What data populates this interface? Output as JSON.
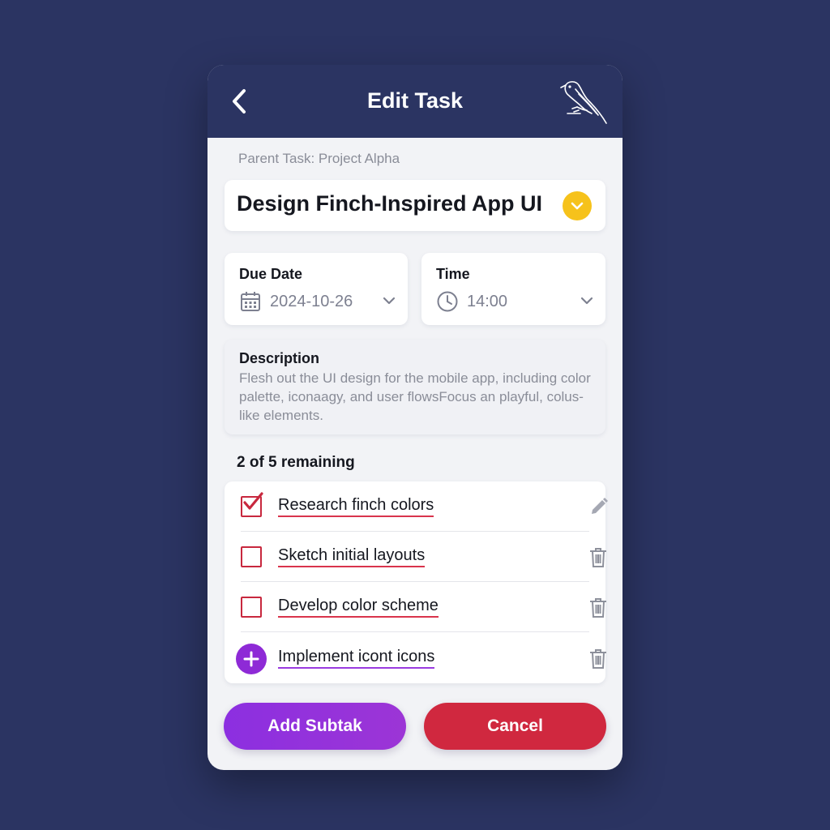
{
  "header": {
    "title": "Edit Task",
    "back_icon": "chevron-left-icon",
    "logo_icon": "finch-bird-icon"
  },
  "task": {
    "parent_label": "Parent Task: Project Alpha",
    "title": "Design Finch-Inspired App UI",
    "status_icon": "check-circle-icon",
    "status_color": "#f6c21b"
  },
  "due_date": {
    "label": "Due Date",
    "value": "2024-10-26",
    "icon": "calendar-icon"
  },
  "time": {
    "label": "Time",
    "value": "14:00",
    "icon": "clock-icon"
  },
  "description": {
    "label": "Description",
    "text": "Flesh out the UI design for the mobile app, including color palette, iconaagy, and user flowsFocus an playful, colus-like elements."
  },
  "subtasks": {
    "remaining_text": "2 of 5 remaining",
    "items": [
      {
        "label": "Research finch colors",
        "checked": true,
        "action_icon": "pencil-icon"
      },
      {
        "label": "Sketch initial layouts",
        "checked": false,
        "action_icon": "trash-icon"
      },
      {
        "label": "Develop color scheme",
        "checked": false,
        "action_icon": "trash-icon"
      },
      {
        "label": "Implement icont icons",
        "checked": false,
        "action_icon": "trash-icon",
        "leading_icon": "plus-icon"
      }
    ]
  },
  "actions": {
    "add_label": "Add Subtak",
    "cancel_label": "Cancel"
  },
  "colors": {
    "header_bg": "#2b3462",
    "accent_purple": "#8c2fe0",
    "accent_red": "#d0283f",
    "accent_yellow": "#f6c21b"
  }
}
